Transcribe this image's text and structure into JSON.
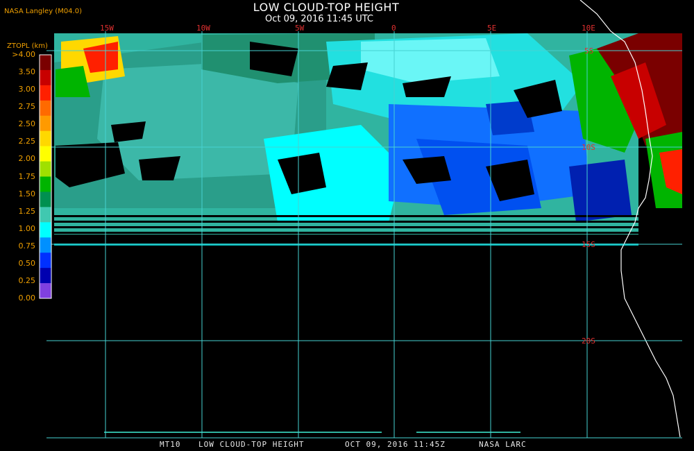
{
  "header": {
    "title": "LOW CLOUD-TOP HEIGHT",
    "subtitle": "Oct 09, 2016 11:45 UTC",
    "credit": "NASA Langley (M04.0)"
  },
  "legend": {
    "title": "ZTOPL (km)",
    "labels": [
      ">4.00",
      "3.50",
      "3.00",
      "2.75",
      "2.50",
      "2.25",
      "2.00",
      "1.75",
      "1.50",
      "1.25",
      "1.00",
      "0.75",
      "0.50",
      "0.25",
      "0.00"
    ],
    "colors": [
      "#7a0000",
      "#c80000",
      "#ff2000",
      "#ff6a00",
      "#ff9a00",
      "#ffd800",
      "#ffff00",
      "#a0e000",
      "#00b400",
      "#009050",
      "#40c8b0",
      "#00ffff",
      "#0090ff",
      "#0030ff",
      "#0000b0",
      "#8040e0"
    ]
  },
  "map": {
    "longitude_labels": [
      "15W",
      "10W",
      "5W",
      "0",
      "5E",
      "10E"
    ],
    "latitude_labels": [
      "5S",
      "10S",
      "15S",
      "20S"
    ],
    "gridline_color": "#46d2d2"
  },
  "footer": {
    "product": "MT10",
    "title": "LOW CLOUD-TOP HEIGHT",
    "datetime": "OCT 09, 2016 11:45Z",
    "source": "NASA LARC"
  }
}
